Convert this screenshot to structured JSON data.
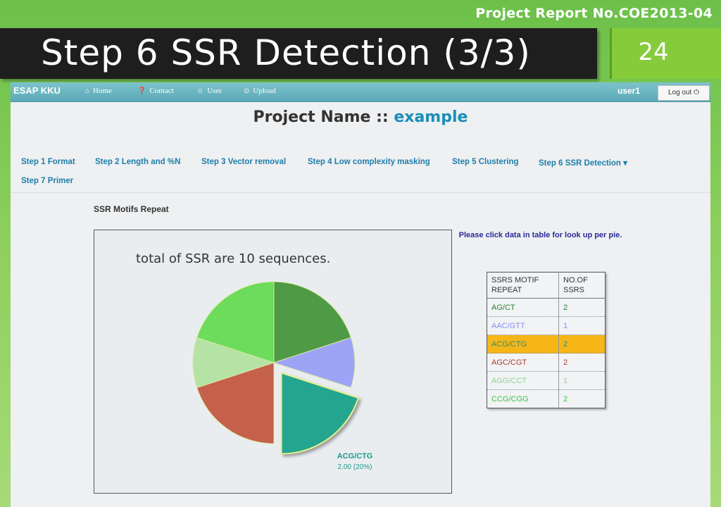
{
  "slide": {
    "report_label": "Project Report No.COE2013-04",
    "title": "Step 6 SSR Detection (3/3)",
    "slide_number": "24"
  },
  "navbar": {
    "brand": "ESAP KKU",
    "items": [
      {
        "label": "Home",
        "icon": "home-icon",
        "glyph": "⌂"
      },
      {
        "label": "Contact",
        "icon": "question-circle-icon",
        "glyph": "❓"
      },
      {
        "label": "User",
        "icon": "user-icon",
        "glyph": "☺"
      },
      {
        "label": "Upload",
        "icon": "upload-icon",
        "glyph": "⊙"
      }
    ],
    "username": "user1",
    "logout_label": "Log out ⏻"
  },
  "project": {
    "prefix": "Project Name :: ",
    "name": "example"
  },
  "steps": [
    {
      "label": "Step 1 Format"
    },
    {
      "label": "Step 2 Length and %N"
    },
    {
      "label": "Step 3 Vector removal"
    },
    {
      "label": "Step 4 Low complexity masking"
    },
    {
      "label": "Step 5 Clustering"
    },
    {
      "label": "Step 6 SSR Detection ▾"
    },
    {
      "label": "Step 7 Primer"
    }
  ],
  "section_title": "SSR Motifs Repeat",
  "hint": "Please click data in table for look up per pie.",
  "table": {
    "headers": [
      "SSRS MOTIF REPEAT",
      "NO.OF SSRS"
    ],
    "rows": [
      {
        "motif": "AG/CT",
        "count": "2",
        "color": "#2e7d32",
        "highlight": false
      },
      {
        "motif": "AAC/GTT",
        "count": "1",
        "color": "#8a8ef0",
        "highlight": false
      },
      {
        "motif": "ACG/CTG",
        "count": "2",
        "color": "#2e8f7a",
        "highlight": true
      },
      {
        "motif": "AGC/CGT",
        "count": "2",
        "color": "#b03a2e",
        "highlight": false
      },
      {
        "motif": "AGG/CCT",
        "count": "1",
        "color": "#8fd68a",
        "highlight": false
      },
      {
        "motif": "CCG/CGG",
        "count": "2",
        "color": "#3ec43e",
        "highlight": false
      }
    ],
    "highlight_color": "#f7b617"
  },
  "chart_data": {
    "type": "pie",
    "title": "total of SSR are 10 sequences.",
    "slices": [
      {
        "label": "AG/CT",
        "value": 2,
        "color": "#4e9a45",
        "exploded": false
      },
      {
        "label": "AAC/GTT",
        "value": 1,
        "color": "#9ea4f5",
        "exploded": false
      },
      {
        "label": "ACG/CTG",
        "value": 2,
        "color": "#23a58f",
        "exploded": true
      },
      {
        "label": "AGC/CGT",
        "value": 2,
        "color": "#c5604a",
        "exploded": false
      },
      {
        "label": "AGG/CCT",
        "value": 1,
        "color": "#b5e3a6",
        "exploded": false
      },
      {
        "label": "CCG/CGG",
        "value": 2,
        "color": "#6ddc5c",
        "exploded": false
      }
    ],
    "tooltip": {
      "label": "ACG/CTG",
      "value": "2.00 (20%)"
    }
  }
}
